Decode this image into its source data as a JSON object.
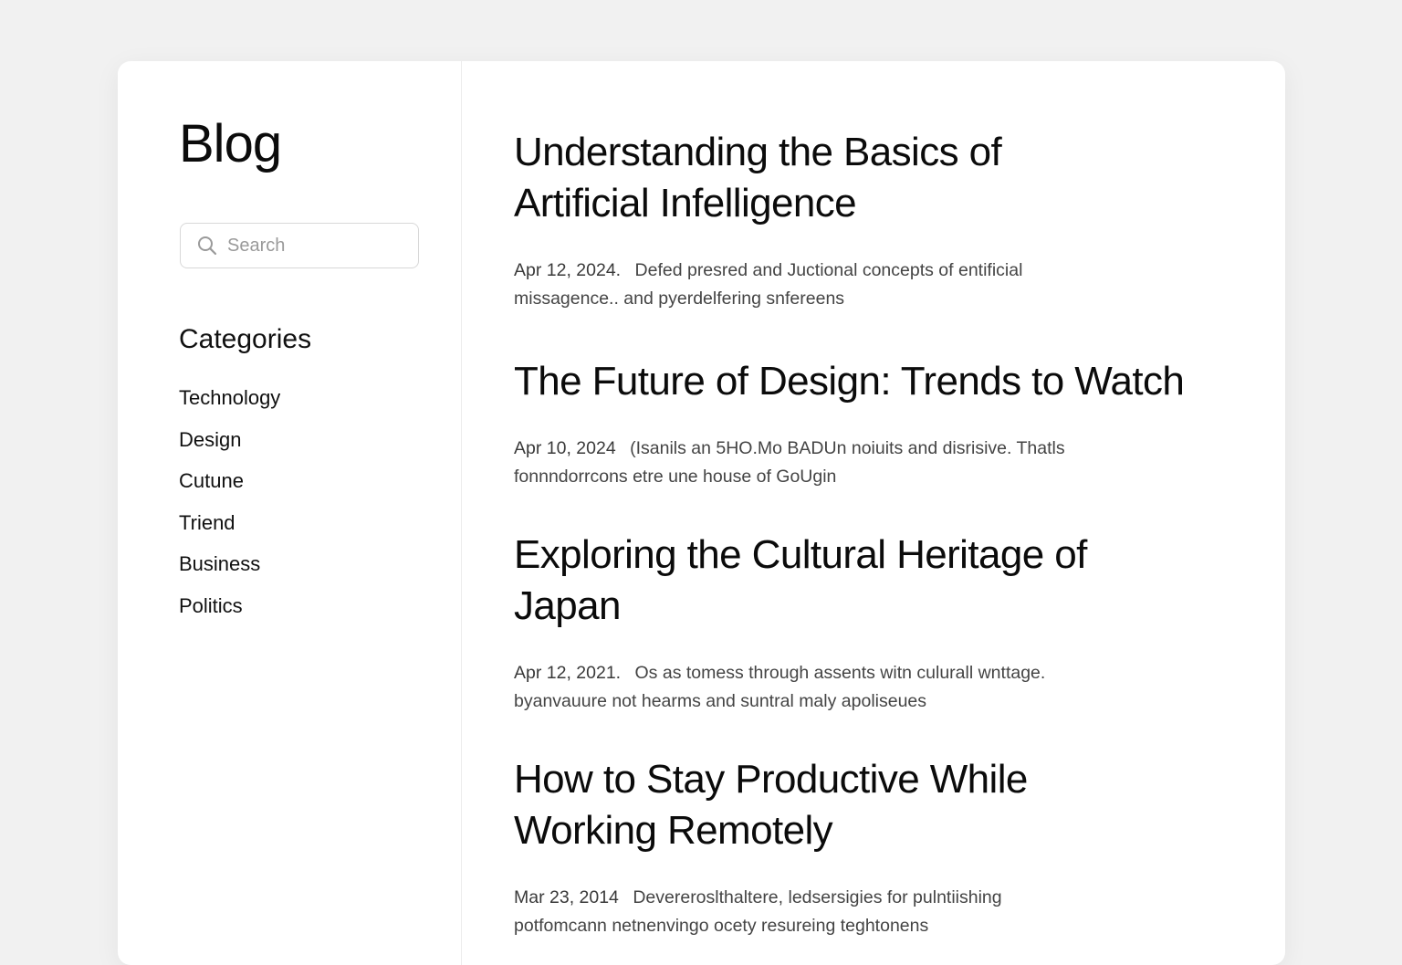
{
  "sidebar": {
    "title": "Blog",
    "search": {
      "placeholder": "Search",
      "icon": "search-icon"
    },
    "categories_heading": "Categories",
    "categories": [
      "Technology",
      "Design",
      "Cutune",
      "Triend",
      "Business",
      "Politics"
    ]
  },
  "posts": [
    {
      "title": "Understanding the Basics of Artificial Infelligence",
      "date": "Apr 12, 2024.",
      "excerpt": "Defed presred and Juctional concepts of entificial missagence.. and pyerdelfering snfereens"
    },
    {
      "title": "The Future of Design: Trends to Watch",
      "date": "Apr 10, 2024",
      "excerpt": "(Isanils an 5HO.Mo BADUn noiuits and disrisive. Thatls fonnndorrcons etre une house of GoUgin"
    },
    {
      "title": "Exploring the Cultural Heritage of Japan",
      "date": "Apr 12, 2021.",
      "excerpt": "Os as tomess through assents witn culurall wnttage. byanvauure not hearms and suntral maly apoliseues"
    },
    {
      "title": "How to Stay Productive While Working Remotely",
      "date": "Mar 23, 2014",
      "excerpt": "Devereroslthaltere, ledsersigies for pulntiishing potfomcann netnenvingo ocety resureing teghtonens"
    }
  ]
}
